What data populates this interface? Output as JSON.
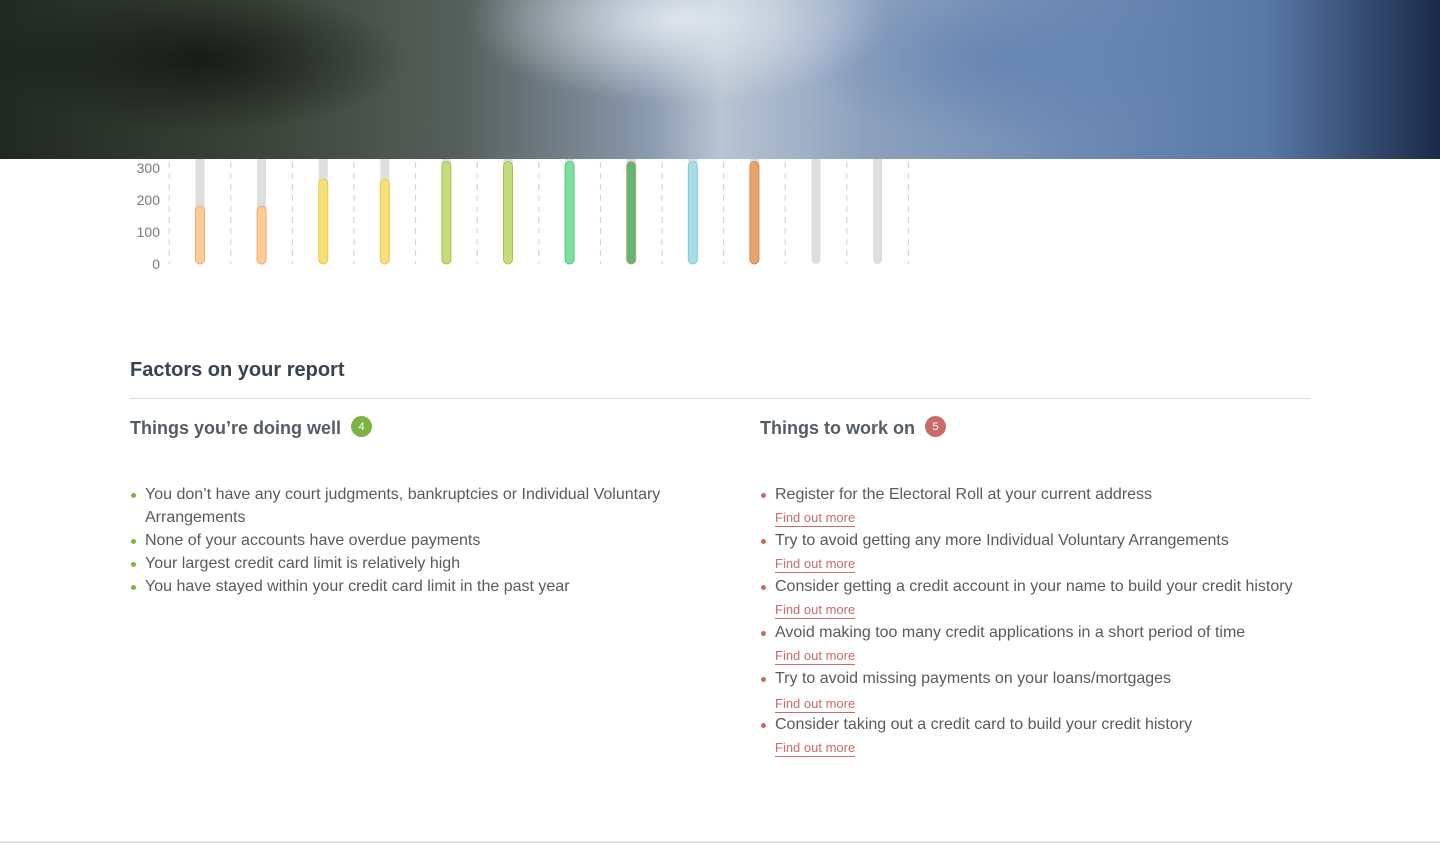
{
  "chart_data": {
    "type": "bar",
    "y_ticks": [
      "300",
      "200",
      "100",
      "0"
    ],
    "ylim": [
      0,
      300
    ],
    "bars": [
      {
        "value": 180,
        "color": "#ffcc99",
        "border": "#f0a86a"
      },
      {
        "value": 180,
        "color": "#ffcc99",
        "border": "#f0a86a"
      },
      {
        "value": 265,
        "color": "#f7e07a",
        "border": "#e6c94a"
      },
      {
        "value": 265,
        "color": "#f7e07a",
        "border": "#e6c94a"
      },
      {
        "value": 320,
        "color": "#c6db7a",
        "border": "#a8c04f"
      },
      {
        "value": 320,
        "color": "#c6db7a",
        "border": "#a8c04f"
      },
      {
        "value": 320,
        "color": "#7ee0a0",
        "border": "#55c47e"
      },
      {
        "value": 320,
        "color": "#5cb877",
        "border": "#d09a5a"
      },
      {
        "value": 320,
        "color": "#a8dde6",
        "border": "#86c6d2"
      },
      {
        "value": 320,
        "color": "#e6a56a",
        "border": "#cf8a4c"
      },
      {
        "value": 0,
        "color": "#dedede",
        "border": "#dedede"
      },
      {
        "value": 0,
        "color": "#dedede",
        "border": "#dedede"
      }
    ]
  },
  "factors": {
    "title": "Factors on your report",
    "doing_well": {
      "heading": "Things you’re doing well",
      "count": "4",
      "items": [
        "You don’t have any court judgments, bankruptcies or Individual Voluntary Arrangements",
        "None of your accounts have overdue payments",
        "Your largest credit card limit is relatively high",
        "You have stayed within your credit card limit in the past year"
      ]
    },
    "work_on": {
      "heading": "Things to work on",
      "count": "5",
      "link_label": "Find out more",
      "items": [
        "Register for the Electoral Roll at your current address",
        "Try to avoid getting any more Individual Voluntary Arrangements",
        "Consider getting a credit account in your name to build your credit history",
        "Avoid making too many credit applications in a short period of time",
        "Try  to avoid missing payments on your loans/mortgages",
        "Consider taking out a credit card to build your credit history"
      ]
    }
  },
  "colors": {
    "good": "#7cb342",
    "bad": "#c96b6b",
    "heading": "#3a4450"
  }
}
